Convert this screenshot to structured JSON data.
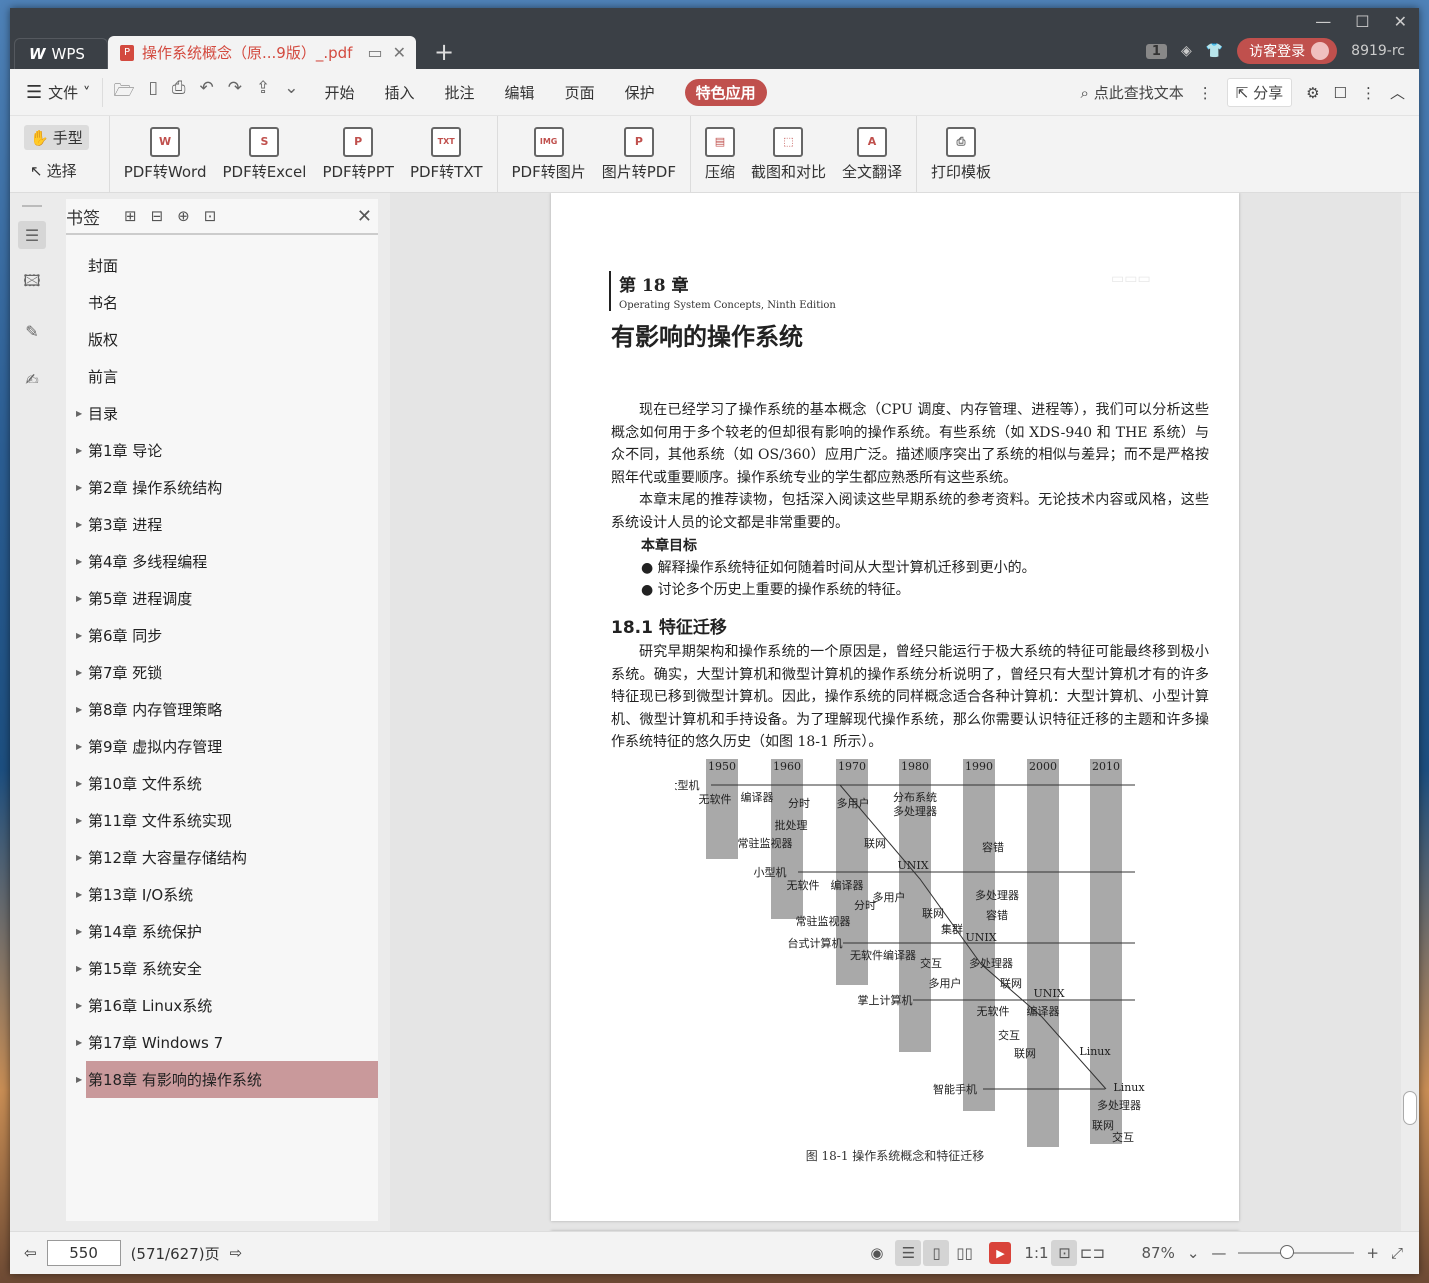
{
  "titlebar": {
    "app_tab": "WPS",
    "doc_tab": "操作系统概念（原...9版）_.pdf",
    "user_count": "1",
    "login_label": "访客登录",
    "user_code": "8919-rc"
  },
  "menubar": {
    "file_label": "文件",
    "tabs": [
      "开始",
      "插入",
      "批注",
      "编辑",
      "页面",
      "保护",
      "特色应用"
    ],
    "active_tab": "特色应用",
    "search_label": "点此查找文本",
    "share_label": "分享"
  },
  "toolbar": {
    "hand_label": "手型",
    "select_label": "选择",
    "convert": [
      {
        "label": "PDF转Word",
        "icon": "W"
      },
      {
        "label": "PDF转Excel",
        "icon": "S"
      },
      {
        "label": "PDF转PPT",
        "icon": "P"
      },
      {
        "label": "PDF转TXT",
        "icon": "TXT"
      },
      {
        "label": "PDF转图片",
        "icon": "IMG"
      },
      {
        "label": "图片转PDF",
        "icon": "P"
      }
    ],
    "tools": [
      {
        "label": "压缩"
      },
      {
        "label": "截图和对比"
      },
      {
        "label": "全文翻译",
        "icon": "A"
      },
      {
        "label": "打印模板"
      }
    ]
  },
  "bookmarks": {
    "title": "书签",
    "items": [
      {
        "label": "封面",
        "expandable": false
      },
      {
        "label": "书名",
        "expandable": false
      },
      {
        "label": "版权",
        "expandable": false
      },
      {
        "label": "前言",
        "expandable": false
      },
      {
        "label": "目录",
        "expandable": true
      },
      {
        "label": "第1章  导论",
        "expandable": true
      },
      {
        "label": "第2章  操作系统结构",
        "expandable": true
      },
      {
        "label": "第3章  进程",
        "expandable": true
      },
      {
        "label": "第4章  多线程编程",
        "expandable": true
      },
      {
        "label": "第5章  进程调度",
        "expandable": true
      },
      {
        "label": "第6章  同步",
        "expandable": true
      },
      {
        "label": "第7章  死锁",
        "expandable": true
      },
      {
        "label": "第8章  内存管理策略",
        "expandable": true
      },
      {
        "label": "第9章  虚拟内存管理",
        "expandable": true
      },
      {
        "label": "第10章  文件系统",
        "expandable": true
      },
      {
        "label": "第11章  文件系统实现",
        "expandable": true
      },
      {
        "label": "第12章  大容量存储结构",
        "expandable": true
      },
      {
        "label": "第13章  I/O系统",
        "expandable": true
      },
      {
        "label": "第14章  系统保护",
        "expandable": true
      },
      {
        "label": "第15章  系统安全",
        "expandable": true
      },
      {
        "label": "第16章  Linux系统",
        "expandable": true
      },
      {
        "label": "第17章  Windows 7",
        "expandable": true
      },
      {
        "label": "第18章  有影响的操作系统",
        "expandable": true,
        "selected": true
      }
    ]
  },
  "page": {
    "chapter_num": "第 18 章",
    "chapter_sub": "Operating System Concepts, Ninth Edition",
    "chapter_title": "有影响的操作系统",
    "para1": "现在已经学习了操作系统的基本概念（CPU 调度、内存管理、进程等），我们可以分析这些概念如何用于多个较老的但却很有影响的操作系统。有些系统（如 XDS-940 和 THE 系统）与众不同，其他系统（如 OS/360）应用广泛。描述顺序突出了系统的相似与差异；而不是严格按照年代或重要顺序。操作系统专业的学生都应熟悉所有这些系统。",
    "para2": "本章末尾的推荐读物，包括深入阅读这些早期系统的参考资料。无论技术内容或风格，这些系统设计人员的论文都是非常重要的。",
    "goals_title": "本章目标",
    "goals": [
      "●  解释操作系统特征如何随着时间从大型计算机迁移到更小的。",
      "●  讨论多个历史上重要的操作系统的特征。"
    ],
    "section_title": "18.1    特征迁移",
    "para3": "研究早期架构和操作系统的一个原因是，曾经只能运行于极大系统的特征可能最终移到极小系统。确实，大型计算机和微型计算机的操作系统分析说明了，曾经只有大型计算机才有的许多特征现已移到微型计算机。因此，操作系统的同样概念适合各种计算机：大型计算机、小型计算机、微型计算机和手持设备。为了理解现代操作系统，那么你需要认识特征迁移的主题和许多操作系统特征的悠久历史（如图 18-1 所示）。",
    "figure_caption": "图 18-1    操作系统概念和特征迁移"
  },
  "figure": {
    "years": [
      "1950",
      "1960",
      "1970",
      "1980",
      "1990",
      "2000",
      "2010"
    ],
    "row_labels": [
      "大型机",
      "小型机",
      "台式计算机",
      "掌上计算机",
      "智能手机"
    ],
    "labels": [
      "无软件",
      "编译器",
      "分时",
      "多用户",
      "分布系统",
      "多处理器",
      "批处理",
      "联网",
      "常驻监视器",
      "容错",
      "UNIX",
      "无软件",
      "编译器",
      "多用户",
      "多处理器",
      "分时",
      "联网",
      "容错",
      "常驻监视器",
      "集群",
      "UNIX",
      "无软件编译器",
      "交互",
      "多处理器",
      "多用户",
      "联网",
      "UNIX",
      "无软件",
      "编译器",
      "交互",
      "联网",
      "Linux",
      "Linux",
      "多处理器",
      "联网",
      "交互"
    ]
  },
  "statusbar": {
    "page_input": "550",
    "page_total": "(571/627)页",
    "zoom": "87%"
  }
}
